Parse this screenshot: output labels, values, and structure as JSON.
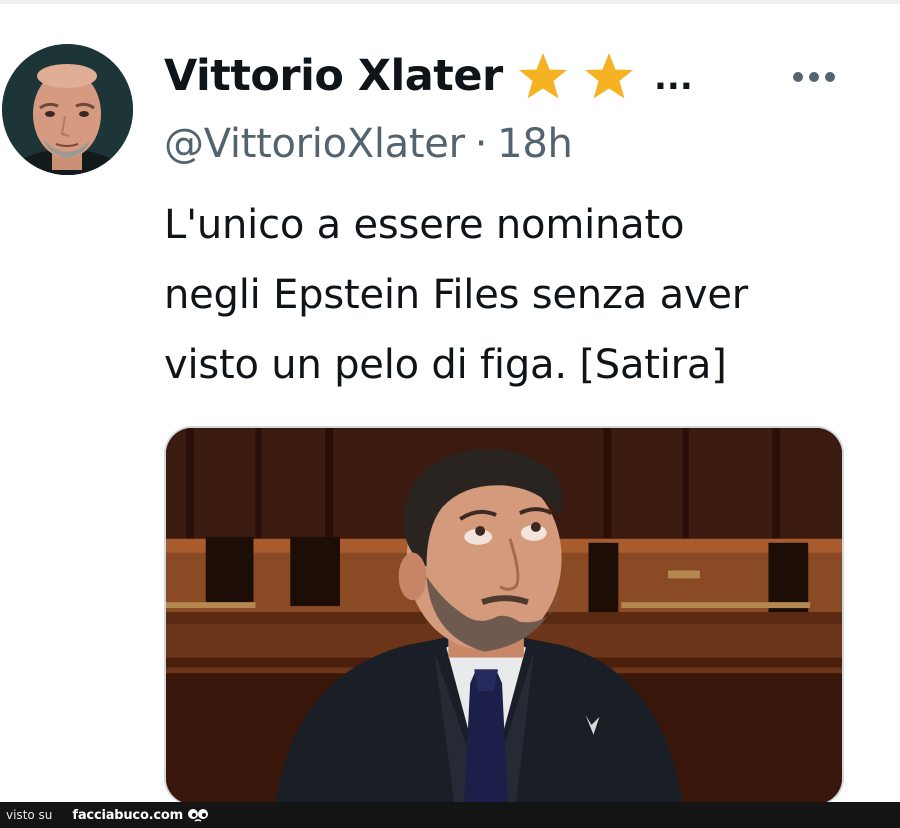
{
  "tweet": {
    "display_name": "Vittorio Xlater",
    "name_ellipsis": "...",
    "handle": "@VittorioXlater",
    "separator": "·",
    "time": "18h",
    "text_lines": [
      "L'unico a essere nominato",
      "negli Epstein Files senza aver",
      "visto un pelo di figa. [Satira]"
    ],
    "badge_color": "#f5b324"
  },
  "footer": {
    "visto_su": "visto su",
    "brand": "facciabuco.com"
  },
  "icons": {
    "avatar": "avatar-photo",
    "badges": [
      "star-icon",
      "star-icon"
    ],
    "more": "more-options-icon",
    "media": "tweet-photo",
    "watermark": "eyes-logo-icon"
  },
  "colors": {
    "text": "#0f1419",
    "secondary_text": "#536471",
    "media_border": "#cfd9de",
    "footer_bg": "#141414"
  }
}
